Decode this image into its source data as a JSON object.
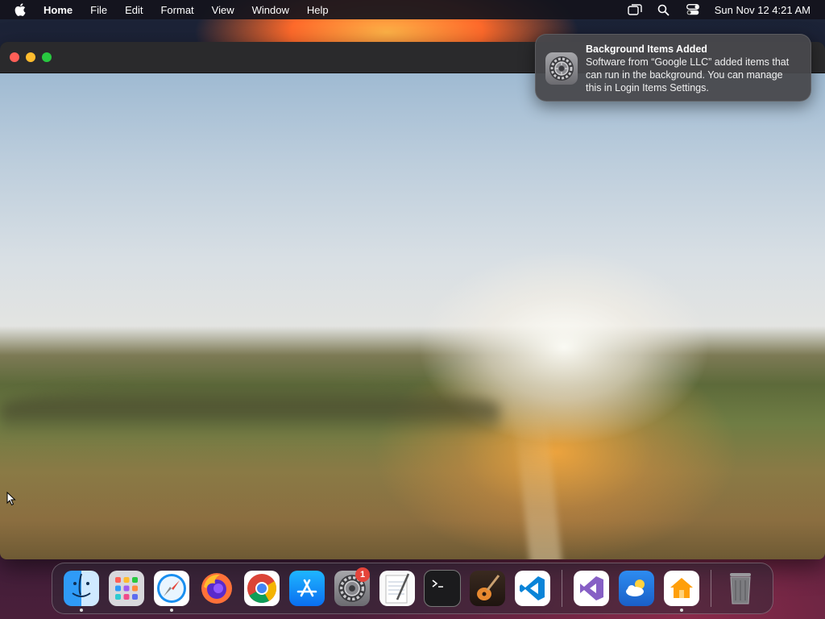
{
  "menubar": {
    "app_name": "Home",
    "items": [
      "File",
      "Edit",
      "Format",
      "View",
      "Window",
      "Help"
    ],
    "clock": "Sun Nov 12  4:21 AM",
    "status_icons": [
      "screen-mirroring-icon",
      "spotlight-search-icon",
      "control-center-icon"
    ]
  },
  "notification": {
    "title": "Background Items Added",
    "body": "Software from “Google LLC” added items that can run in the background. You can manage this in Login Items Settings.",
    "icon": "system-settings-icon"
  },
  "dock": {
    "apps": [
      {
        "name": "Finder",
        "icon": "finder-icon",
        "running": true
      },
      {
        "name": "Launchpad",
        "icon": "launchpad-icon",
        "running": false
      },
      {
        "name": "Safari",
        "icon": "safari-icon",
        "running": true
      },
      {
        "name": "Firefox",
        "icon": "firefox-icon",
        "running": false
      },
      {
        "name": "Google Chrome",
        "icon": "chrome-icon",
        "running": false
      },
      {
        "name": "App Store",
        "icon": "app-store-icon",
        "running": false
      },
      {
        "name": "System Settings",
        "icon": "system-settings-icon",
        "running": false,
        "badge": "1"
      },
      {
        "name": "TextEdit",
        "icon": "textedit-icon",
        "running": false
      },
      {
        "name": "Terminal",
        "icon": "terminal-icon",
        "running": false
      },
      {
        "name": "GarageBand",
        "icon": "garageband-icon",
        "running": false
      },
      {
        "name": "Visual Studio Code",
        "icon": "vscode-icon",
        "running": false
      },
      {
        "name": "Visual Studio",
        "icon": "visual-studio-icon",
        "running": false
      },
      {
        "name": "Weather",
        "icon": "weather-icon",
        "running": false
      },
      {
        "name": "Home",
        "icon": "home-icon",
        "running": true
      },
      {
        "name": "Trash",
        "icon": "trash-icon",
        "running": false
      }
    ]
  },
  "colors": {
    "close": "#ff5f57",
    "minimize": "#febc2e",
    "zoom": "#28c840",
    "badge": "#e5443a"
  }
}
